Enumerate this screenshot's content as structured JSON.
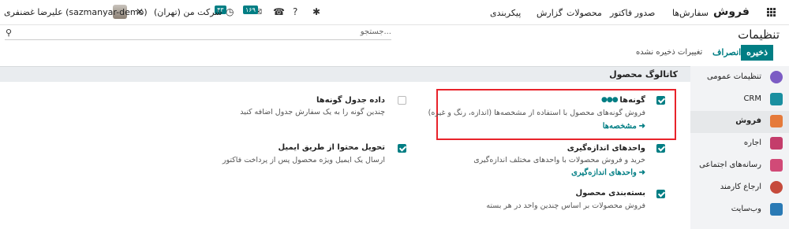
{
  "topbar": {
    "brand": "فروش",
    "nav": [
      "سفارش‌ها",
      "صدور فاکتور",
      "محصولات",
      "گزارش",
      "پیکربندی"
    ],
    "user_name": "علیرضا غضنفری (sazmanyar-demo)",
    "company": "شرکت من (تهران)",
    "activity_badge": "۴۳",
    "message_badge": "۱۶۹"
  },
  "control_panel": {
    "title": "تنظیمات",
    "search_placeholder": "جستجو...",
    "save_label": "ذخیره",
    "discard_label": "انصراف",
    "unsaved_label": "تغییرات ذخیره نشده"
  },
  "section": {
    "title": "کاتالوگ محصول"
  },
  "sidebar": {
    "items": [
      {
        "label": "تنظیمات عمومی",
        "color": "#7c5cc4"
      },
      {
        "label": "CRM",
        "color": "#1a8fa0"
      },
      {
        "label": "فروش",
        "color": "#e57a3a"
      },
      {
        "label": "اجاره",
        "color": "#c43d6b"
      },
      {
        "label": "رسانه‌های اجتماعی",
        "color": "#d14a77"
      },
      {
        "label": "ارجاع کارمند",
        "color": "#c64b3c"
      },
      {
        "label": "وب‌سایت",
        "color": "#2a7ab5"
      }
    ]
  },
  "settings": {
    "variants": {
      "title": "گونه‌ها",
      "desc": "فروش گونه‌های محصول با استفاده از مشخصه‌ها (اندازه، رنگ و غیره)",
      "link": "مشخصه‌ها",
      "checked": true
    },
    "variant_grid": {
      "title": "داده جدول گونه‌ها",
      "desc": "چندین گونه را به یک سفارش جدول اضافه کنید",
      "checked": false
    },
    "uom": {
      "title": "واحدهای اندازه‌گیری",
      "desc": "خرید و فروش محصولات با واحدهای مختلف اندازه‌گیری",
      "link": "واحدهای اندازه‌گیری",
      "checked": true
    },
    "email_content": {
      "title": "تحویل محتوا از طریق ایمیل",
      "desc": "ارسال یک ایمیل ویژه محصول پس از پرداخت فاکتور",
      "checked": true
    },
    "packaging": {
      "title": "بسته‌بندی محصول",
      "desc": "فروش محصولات بر اساس چندین واحد در هر بسته",
      "checked": true
    }
  }
}
